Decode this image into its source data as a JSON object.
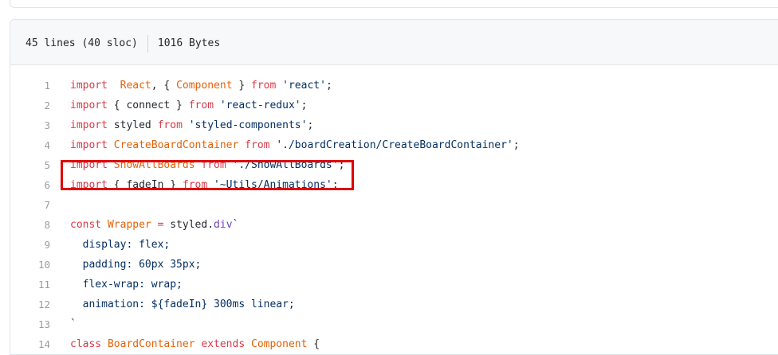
{
  "file_header": {
    "lines_info": "45 lines (40 sloc)",
    "size_info": "1016 Bytes"
  },
  "code_lines": [
    {
      "num": "1",
      "tokens": [
        [
          "kw",
          "import"
        ],
        [
          "",
          "  "
        ],
        [
          "id",
          "React"
        ],
        [
          "",
          ", { "
        ],
        [
          "id",
          "Component"
        ],
        [
          "",
          " } "
        ],
        [
          "kw",
          "from"
        ],
        [
          "",
          " "
        ],
        [
          "str",
          "'react'"
        ],
        [
          "",
          ";"
        ]
      ]
    },
    {
      "num": "2",
      "tokens": [
        [
          "kw",
          "import"
        ],
        [
          "",
          " { connect } "
        ],
        [
          "kw",
          "from"
        ],
        [
          "",
          " "
        ],
        [
          "str",
          "'react-redux'"
        ],
        [
          "",
          ";"
        ]
      ]
    },
    {
      "num": "3",
      "tokens": [
        [
          "kw",
          "import"
        ],
        [
          "",
          " styled "
        ],
        [
          "kw",
          "from"
        ],
        [
          "",
          " "
        ],
        [
          "str",
          "'styled-components'"
        ],
        [
          "",
          ";"
        ]
      ]
    },
    {
      "num": "4",
      "tokens": [
        [
          "kw",
          "import"
        ],
        [
          "",
          " "
        ],
        [
          "id",
          "CreateBoardContainer"
        ],
        [
          "",
          " "
        ],
        [
          "kw",
          "from"
        ],
        [
          "",
          " "
        ],
        [
          "str",
          "'./boardCreation/CreateBoardContainer'"
        ],
        [
          "",
          ";"
        ]
      ]
    },
    {
      "num": "5",
      "tokens": [
        [
          "kw",
          "import"
        ],
        [
          "",
          " "
        ],
        [
          "id",
          "ShowAllBoards"
        ],
        [
          "",
          " "
        ],
        [
          "kw",
          "from"
        ],
        [
          "",
          " "
        ],
        [
          "str",
          "'./ShowAllBoards'"
        ],
        [
          "",
          ";"
        ]
      ]
    },
    {
      "num": "6",
      "tokens": [
        [
          "kw",
          "import"
        ],
        [
          "",
          " { fadeIn } "
        ],
        [
          "kw",
          "from"
        ],
        [
          "",
          " "
        ],
        [
          "str",
          "'~Utils/Animations'"
        ],
        [
          "",
          ";"
        ]
      ]
    },
    {
      "num": "7",
      "tokens": []
    },
    {
      "num": "8",
      "tokens": [
        [
          "kw",
          "const"
        ],
        [
          "",
          " "
        ],
        [
          "id",
          "Wrapper"
        ],
        [
          "",
          " "
        ],
        [
          "kw",
          "="
        ],
        [
          "",
          " styled."
        ],
        [
          "fn",
          "div"
        ],
        [
          "str",
          "`"
        ]
      ]
    },
    {
      "num": "9",
      "tokens": [
        [
          "str",
          "  display: flex;"
        ]
      ]
    },
    {
      "num": "10",
      "tokens": [
        [
          "str",
          "  padding: 60px 35px;"
        ]
      ]
    },
    {
      "num": "11",
      "tokens": [
        [
          "str",
          "  flex-wrap: wrap;"
        ]
      ]
    },
    {
      "num": "12",
      "tokens": [
        [
          "str",
          "  animation: ${fadeIn} 300ms linear;"
        ]
      ]
    },
    {
      "num": "13",
      "tokens": [
        [
          "str",
          "`"
        ]
      ]
    },
    {
      "num": "14",
      "tokens": [
        [
          "kw",
          "class"
        ],
        [
          "",
          " "
        ],
        [
          "id",
          "BoardContainer"
        ],
        [
          "",
          " "
        ],
        [
          "kw",
          "extends"
        ],
        [
          "",
          " "
        ],
        [
          "id",
          "Component"
        ],
        [
          "",
          " {"
        ]
      ]
    }
  ]
}
